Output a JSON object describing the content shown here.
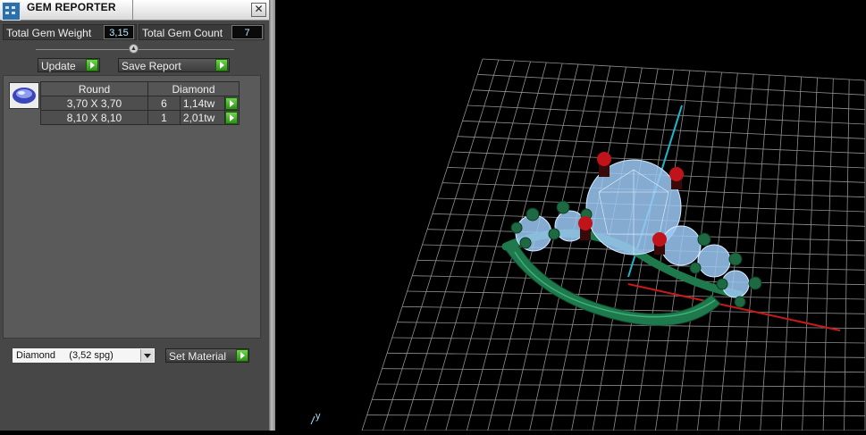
{
  "window": {
    "title": "GEM REPORTER",
    "close_glyph": "✕"
  },
  "totals": {
    "weight_label": "Total Gem Weight",
    "weight_value": "3,15",
    "count_label": "Total Gem Count",
    "count_value": "7"
  },
  "actions": {
    "update_label": "Update",
    "save_report_label": "Save Report"
  },
  "gem_table": {
    "header": {
      "shape": "Round",
      "material": "Diamond"
    },
    "rows": [
      {
        "size": "3,70 X 3,70",
        "count": "6",
        "weight": "1,14tw"
      },
      {
        "size": "8,10 X 8,10",
        "count": "1",
        "weight": "2,01tw"
      }
    ]
  },
  "material": {
    "selected": "Diamond     (3,52 spg)",
    "set_label": "Set Material"
  },
  "viewport": {
    "axis_label": "y",
    "colors": {
      "metal": "#1e7a4c",
      "gem": "#9ec9f5",
      "prong_tip": "#c0141a",
      "grid": "#9a9a9a",
      "y_axis": "#1fb6c9",
      "x_axis": "#c81a1a"
    }
  },
  "icons": [
    "app-icon",
    "close-icon",
    "slider-knob-icon",
    "go-arrow-icon",
    "gem-thumbnail-icon",
    "dropdown-arrow-icon"
  ]
}
